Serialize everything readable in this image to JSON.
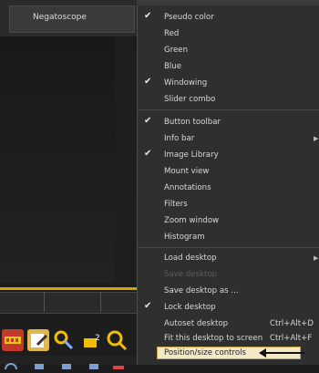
{
  "left_panel": {
    "selected_item": "Negatoscope"
  },
  "menu": {
    "items": [
      {
        "label": "Pseudo color",
        "checked": true
      },
      {
        "label": "Red"
      },
      {
        "label": "Green"
      },
      {
        "label": "Blue"
      },
      {
        "label": "Windowing",
        "checked": true
      },
      {
        "label": "Slider combo"
      },
      {
        "label": "Button toolbar",
        "checked": true
      },
      {
        "label": "Info bar",
        "submenu": true
      },
      {
        "label": "Image Library",
        "checked": true
      },
      {
        "label": "Mount view"
      },
      {
        "label": "Annotations"
      },
      {
        "label": "Filters"
      },
      {
        "label": "Zoom window"
      },
      {
        "label": "Histogram"
      },
      {
        "label": "Load desktop",
        "submenu": true
      },
      {
        "label": "Save desktop",
        "disabled": true
      },
      {
        "label": "Save desktop as ..."
      },
      {
        "label": "Lock desktop",
        "checked": true
      },
      {
        "label": "Autoset desktop",
        "shortcut": "Ctrl+Alt+D"
      },
      {
        "label": "Fit this desktop to screen",
        "shortcut": "Ctrl+Alt+F"
      }
    ],
    "highlighted_item": "Position/size controls"
  }
}
